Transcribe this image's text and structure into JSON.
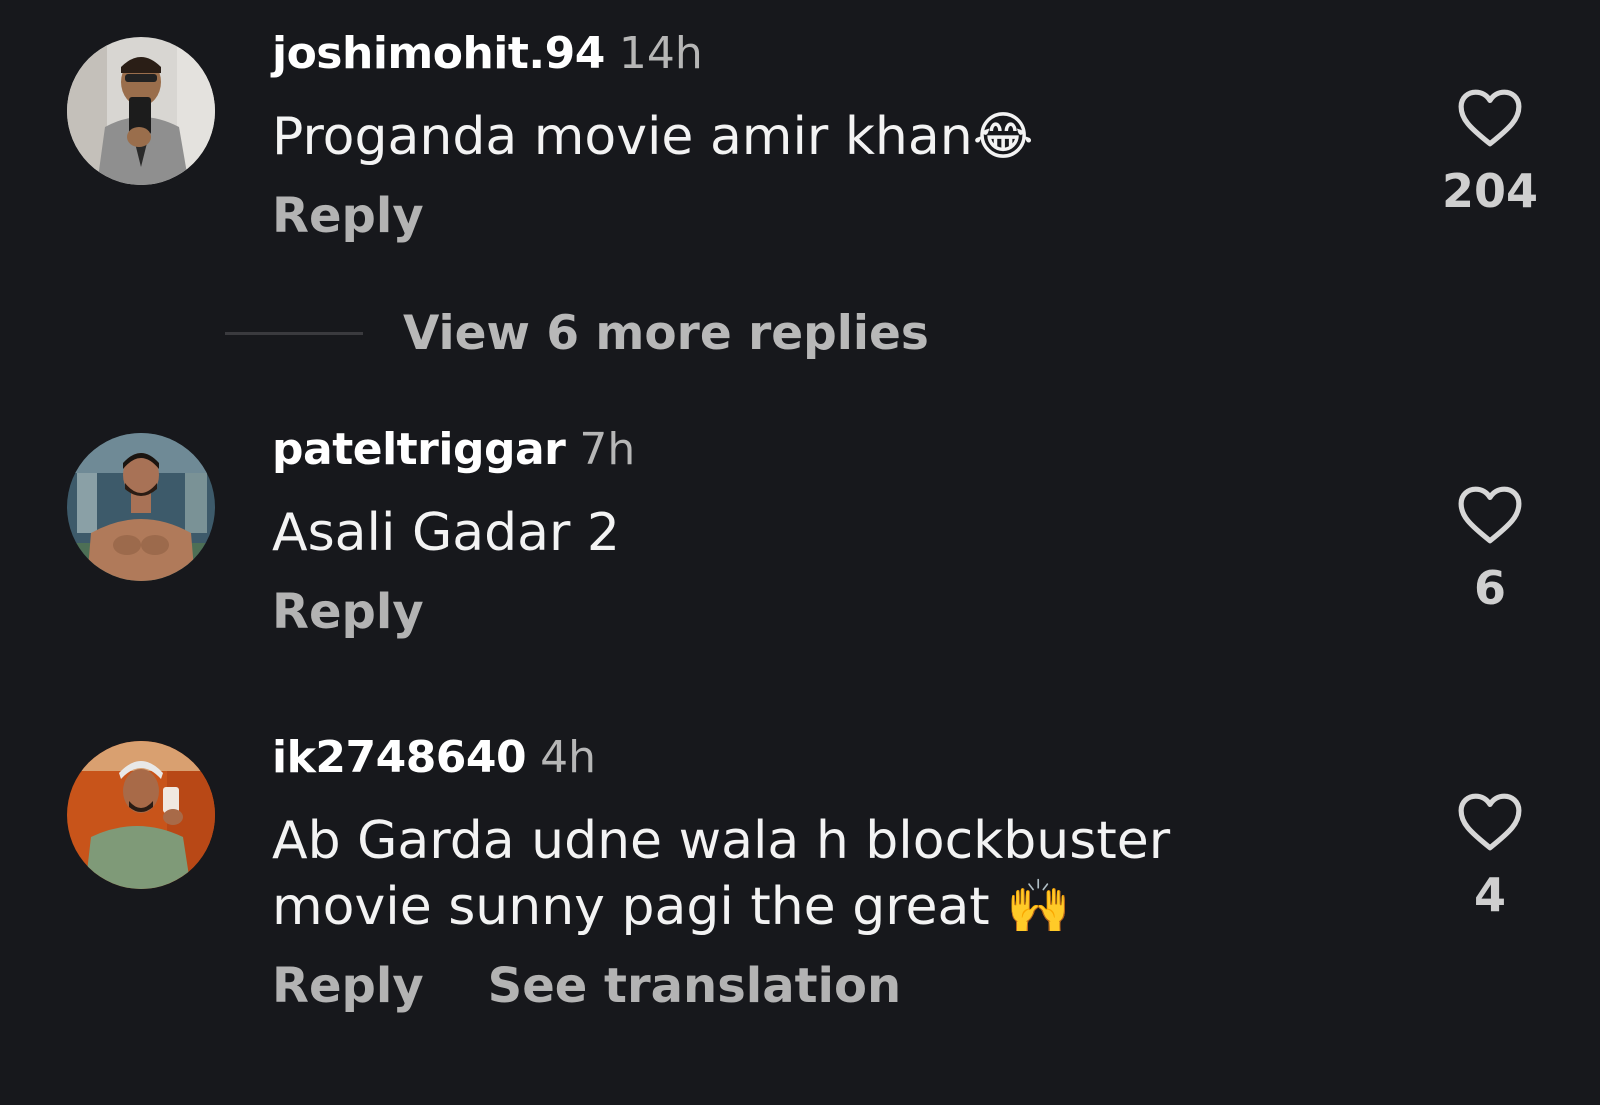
{
  "comments": [
    {
      "username": "joshimohit.94",
      "time": "14h",
      "text": "Proganda movie amir khan😂",
      "reply_label": "Reply",
      "likes": "204"
    },
    {
      "username": "pateltriggar",
      "time": "7h",
      "text": "Asali Gadar 2",
      "reply_label": "Reply",
      "likes": "6"
    },
    {
      "username": "ik2748640",
      "time": "4h",
      "text_line1": "Ab Garda udne wala h blockbuster",
      "text_line2": "movie sunny pagi the great 🙌",
      "reply_label": "Reply",
      "translate_label": "See translation",
      "likes": "4"
    }
  ],
  "view_replies_label": "View 6 more replies",
  "icons": {
    "like": "heart-outline-icon"
  },
  "colors": {
    "background": "#17181c",
    "primary_text": "#f3f3f3",
    "secondary_text": "#b3b3b3"
  }
}
